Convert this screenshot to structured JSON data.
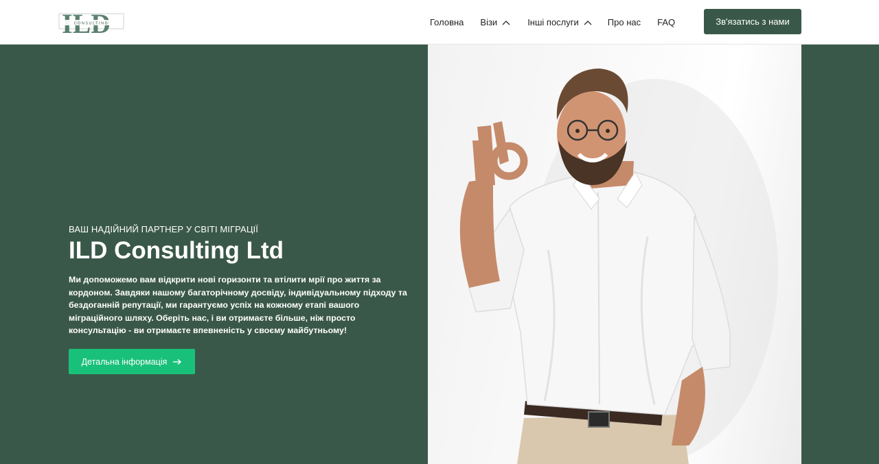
{
  "header": {
    "logo_text": "ILD",
    "logo_subtext": "CONSULTING",
    "nav": [
      {
        "label": "Головна",
        "has_dropdown": false
      },
      {
        "label": "Візи",
        "has_dropdown": true
      },
      {
        "label": "Інші послуги",
        "has_dropdown": true
      },
      {
        "label": "Про нас",
        "has_dropdown": false
      },
      {
        "label": "FAQ",
        "has_dropdown": false
      }
    ],
    "cta_label": "Зв'язатись з нами"
  },
  "hero": {
    "eyebrow": "ВАШ НАДІЙНИЙ ПАРТНЕР У СВІТІ МІГРАЦІЇ",
    "title": "ILD Consulting Ltd",
    "description": "Ми допоможемо вам відкрити нові горизонти та втілити мрії про життя за кордоном. Завдяки нашому багаторічному досвіду, індивідуальному підходу та бездоганній репутації, ми гарантуємо успіх на кожному етапі вашого міграційного шляху. Оберіть нас, і ви отримаєте більше, ніж просто консультацію - ви отримаєте впевненість у своєму майбутньому!",
    "button_label": "Детальна інформація"
  },
  "icons": {
    "dropdown": "chevron-up-icon",
    "button": "arrow-right-icon"
  },
  "colors": {
    "brand_green": "#3a5849",
    "accent_green": "#19c07a"
  }
}
